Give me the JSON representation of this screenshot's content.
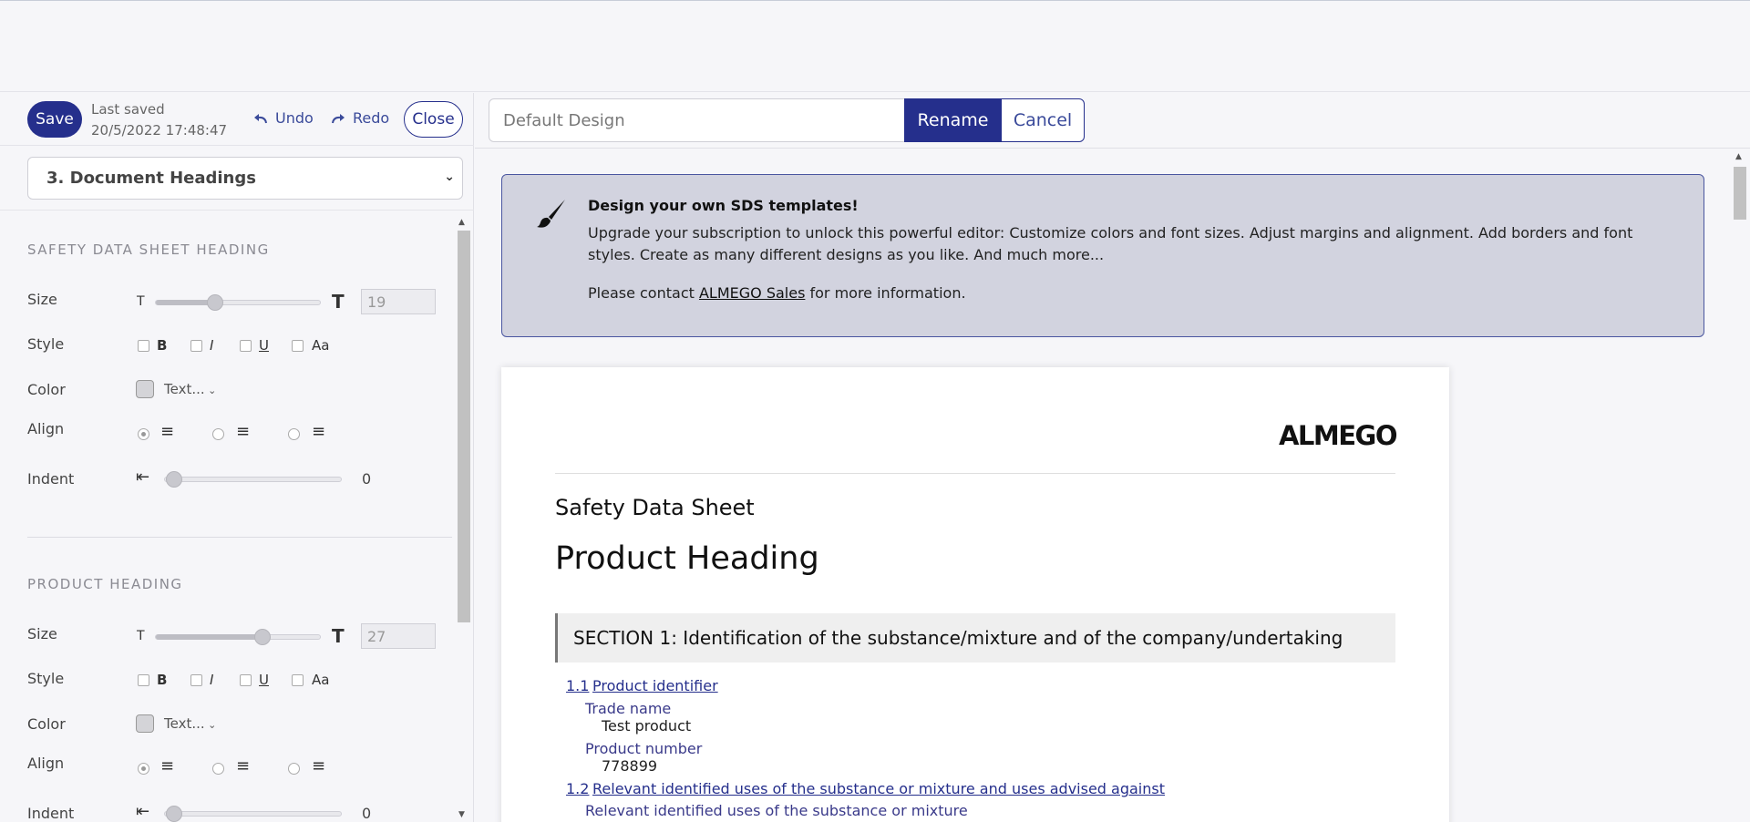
{
  "toolbar": {
    "save_label": "Save",
    "last_saved_label": "Last saved",
    "last_saved_time": "20/5/2022 17:48:47",
    "undo_label": "Undo",
    "redo_label": "Redo",
    "close_label": "Close"
  },
  "section_select": {
    "value": "3. Document Headings"
  },
  "groups": [
    {
      "title": "SAFETY DATA SHEET HEADING",
      "size_label": "Size",
      "size_value": "19",
      "size_fraction": 0.36,
      "style_label": "Style",
      "style_options": [
        "B",
        "I",
        "U",
        "Aa"
      ],
      "color_label": "Color",
      "color_text": "Text...",
      "align_label": "Align",
      "indent_label": "Indent",
      "indent_value": "0"
    },
    {
      "title": "PRODUCT HEADING",
      "size_label": "Size",
      "size_value": "27",
      "size_fraction": 0.64,
      "style_label": "Style",
      "style_options": [
        "B",
        "I",
        "U",
        "Aa"
      ],
      "color_label": "Color",
      "color_text": "Text...",
      "align_label": "Align",
      "indent_label": "Indent",
      "indent_value": "0"
    }
  ],
  "design": {
    "name_value": "Default Design",
    "rename_label": "Rename",
    "cancel_label": "Cancel"
  },
  "promo": {
    "title": "Design your own SDS templates!",
    "body": "Upgrade your subscription to unlock this powerful editor: Customize colors and font sizes. Adjust margins and alignment. Add borders and font styles. Create as many different designs as you like. And much more...",
    "contact_prefix": "Please contact ",
    "contact_link": "ALMEGO Sales",
    "contact_suffix": " for more information."
  },
  "doc": {
    "logo": "ALMEGO",
    "sds_heading": "Safety Data Sheet",
    "product_heading": "Product Heading",
    "section_title": "SECTION 1: Identification of the substance/mixture and of the company/undertaking",
    "s11_num": "1.1",
    "s11_title": "Product identifier",
    "trade_name_label": "Trade name",
    "trade_name_value": "Test product",
    "product_number_label": "Product number",
    "product_number_value": "778899",
    "s12_num": "1.2",
    "s12_title": "Relevant identified uses of the substance or mixture and uses advised against",
    "relevant_uses_label": "Relevant identified uses of the substance or mixture"
  },
  "colors": {
    "primary": "#252f8c",
    "promo_bg": "#d2d3df"
  }
}
